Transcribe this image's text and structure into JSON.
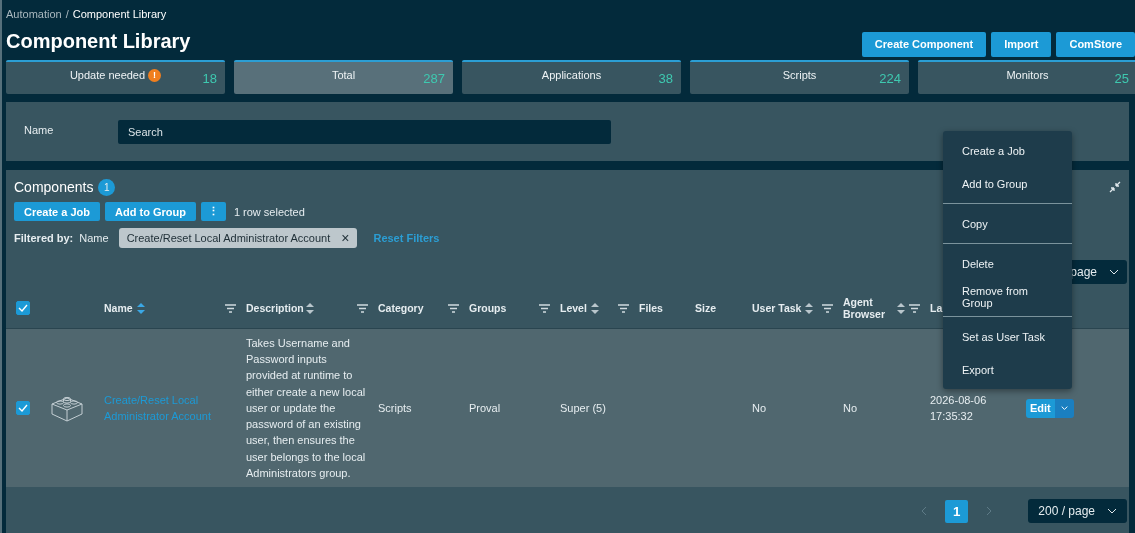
{
  "breadcrumb": {
    "parent": "Automation",
    "separator": "/",
    "current": "Component Library"
  },
  "title": "Component Library",
  "header_buttons": [
    "Create Component",
    "Import",
    "ComStore"
  ],
  "stats": [
    {
      "label": "Update needed",
      "count": "18",
      "alert": "!",
      "selected": false
    },
    {
      "label": "Total",
      "count": "287",
      "selected": true
    },
    {
      "label": "Applications",
      "count": "38",
      "selected": false
    },
    {
      "label": "Scripts",
      "count": "224",
      "selected": false
    },
    {
      "label": "Monitors",
      "count": "25",
      "selected": false
    }
  ],
  "filter_panel": {
    "label": "Name",
    "placeholder": "Search"
  },
  "components": {
    "title": "Components",
    "badge": "1",
    "actions": [
      "Create a Job",
      "Add to Group"
    ],
    "more": "⋮",
    "selection": "1 row selected",
    "filtered_by": "Filtered by:",
    "filter_field": "Name",
    "filter_chip": "Create/Reset Local Administrator Account",
    "chip_close": "×",
    "reset": "Reset Filters",
    "top_page_size": "page",
    "columns": [
      {
        "label": "Name",
        "sortable": true,
        "sort_active": true,
        "filterable": true
      },
      {
        "label": "Description",
        "sortable": true,
        "sort_active": false,
        "filterable": true
      },
      {
        "label": "Category",
        "sortable": false,
        "filterable": true
      },
      {
        "label": "Groups",
        "sortable": false,
        "filterable": true
      },
      {
        "label": "Level",
        "sortable": true,
        "sort_active": false,
        "filterable": true
      },
      {
        "label": "Files",
        "sortable": false,
        "filterable": false
      },
      {
        "label": "Size",
        "sortable": false,
        "filterable": false
      },
      {
        "label": "User Task",
        "sortable": true,
        "sort_active": false,
        "filterable": true
      },
      {
        "label": "Agent Browser",
        "sortable": true,
        "sort_active": false,
        "filterable": true
      },
      {
        "label": "La",
        "sortable": false,
        "filterable": false
      }
    ],
    "all_checked": true,
    "rows": [
      {
        "checked": true,
        "name": "Create/Reset Local Administrator Account",
        "description": "Takes Username and Password inputs provided at runtime to either create a new local user or update the password of an existing user, then ensures the user belongs to the local Administrators group.",
        "category": "Scripts",
        "groups": "Proval",
        "level": "Super (5)",
        "user_task": "No",
        "agent_browser": "No",
        "last": "2026-08-06 17:35:32",
        "action": "Edit"
      }
    ],
    "pagination": {
      "pages": [
        {
          "label": "1",
          "selected": true
        }
      ],
      "page_size": "200 / page"
    }
  },
  "menu": [
    [
      {
        "label": "Create a Job"
      },
      {
        "label": "Add to Group"
      }
    ],
    [
      {
        "label": "Copy"
      }
    ],
    [
      {
        "label": "Delete"
      },
      {
        "label": "Remove from Group"
      }
    ],
    [
      {
        "label": "Set as User Task"
      },
      {
        "label": "Export"
      }
    ]
  ]
}
